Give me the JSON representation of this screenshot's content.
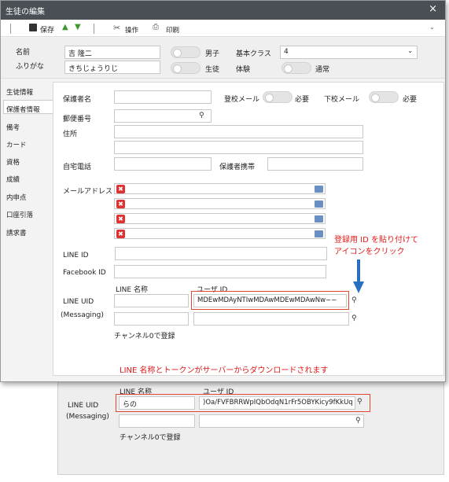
{
  "window": {
    "title": "生徒の編集",
    "close": "×"
  },
  "toolbar": {
    "save": "保存",
    "operation": "操作",
    "print": "印刷"
  },
  "header": {
    "name_label": "名前",
    "name_value": "吉 隆二",
    "furigana_label": "ふりがな",
    "furigana_value": "きちじょうりじ",
    "male_label": "男子",
    "student_label": "生徒",
    "class_label": "基本クラス",
    "class_value": "4",
    "trial_label": "体験",
    "regular_label": "通常"
  },
  "sidebar": {
    "items": [
      "生徒情報",
      "保護者情報",
      "備考",
      "カード",
      "資格",
      "成績",
      "内申点",
      "口座引落",
      "請求書"
    ]
  },
  "form": {
    "guardian_label": "保護者名",
    "school_mail_label": "登校メール",
    "home_mail_label": "下校メール",
    "required": "必要",
    "zip_label": "郵便番号",
    "address_label": "住所",
    "phone_label": "自宅電話",
    "mobile_label": "保護者携帯",
    "mail_label": "メールアドレス",
    "line_id_label": "LINE ID",
    "facebook_label": "Facebook ID",
    "line_name_label": "LINE 名称",
    "user_id_label": "ユーザ ID",
    "line_uid_label": "LINE UID",
    "messaging_label": "(Messaging)",
    "user_id_value": "MDEwMDAyNTIwMDAwMDEwMDAwNw−−",
    "channel_label": "チャンネル0で登録"
  },
  "annotations": {
    "paste_line1": "登録用 ID を貼り付けて",
    "paste_line2": "アイコンをクリック",
    "download_note": "LINE 名称とトークンがサーバーからダウンロードされます"
  },
  "result": {
    "line_name_label": "LINE 名称",
    "user_id_label": "ユーザ ID",
    "line_uid_label": "LINE UID",
    "messaging_label": "(Messaging)",
    "line_name_value": "らの",
    "user_id_value": ")Oa/FVFBRRWpIQbOdqN1rFr5OBYKicy9fKkUq",
    "channel_label": "チャンネル0で登録"
  },
  "colors": {
    "accent_red": "#e01919",
    "arrow_blue": "#2a6fc0",
    "titlebar": "#4a4f55"
  }
}
